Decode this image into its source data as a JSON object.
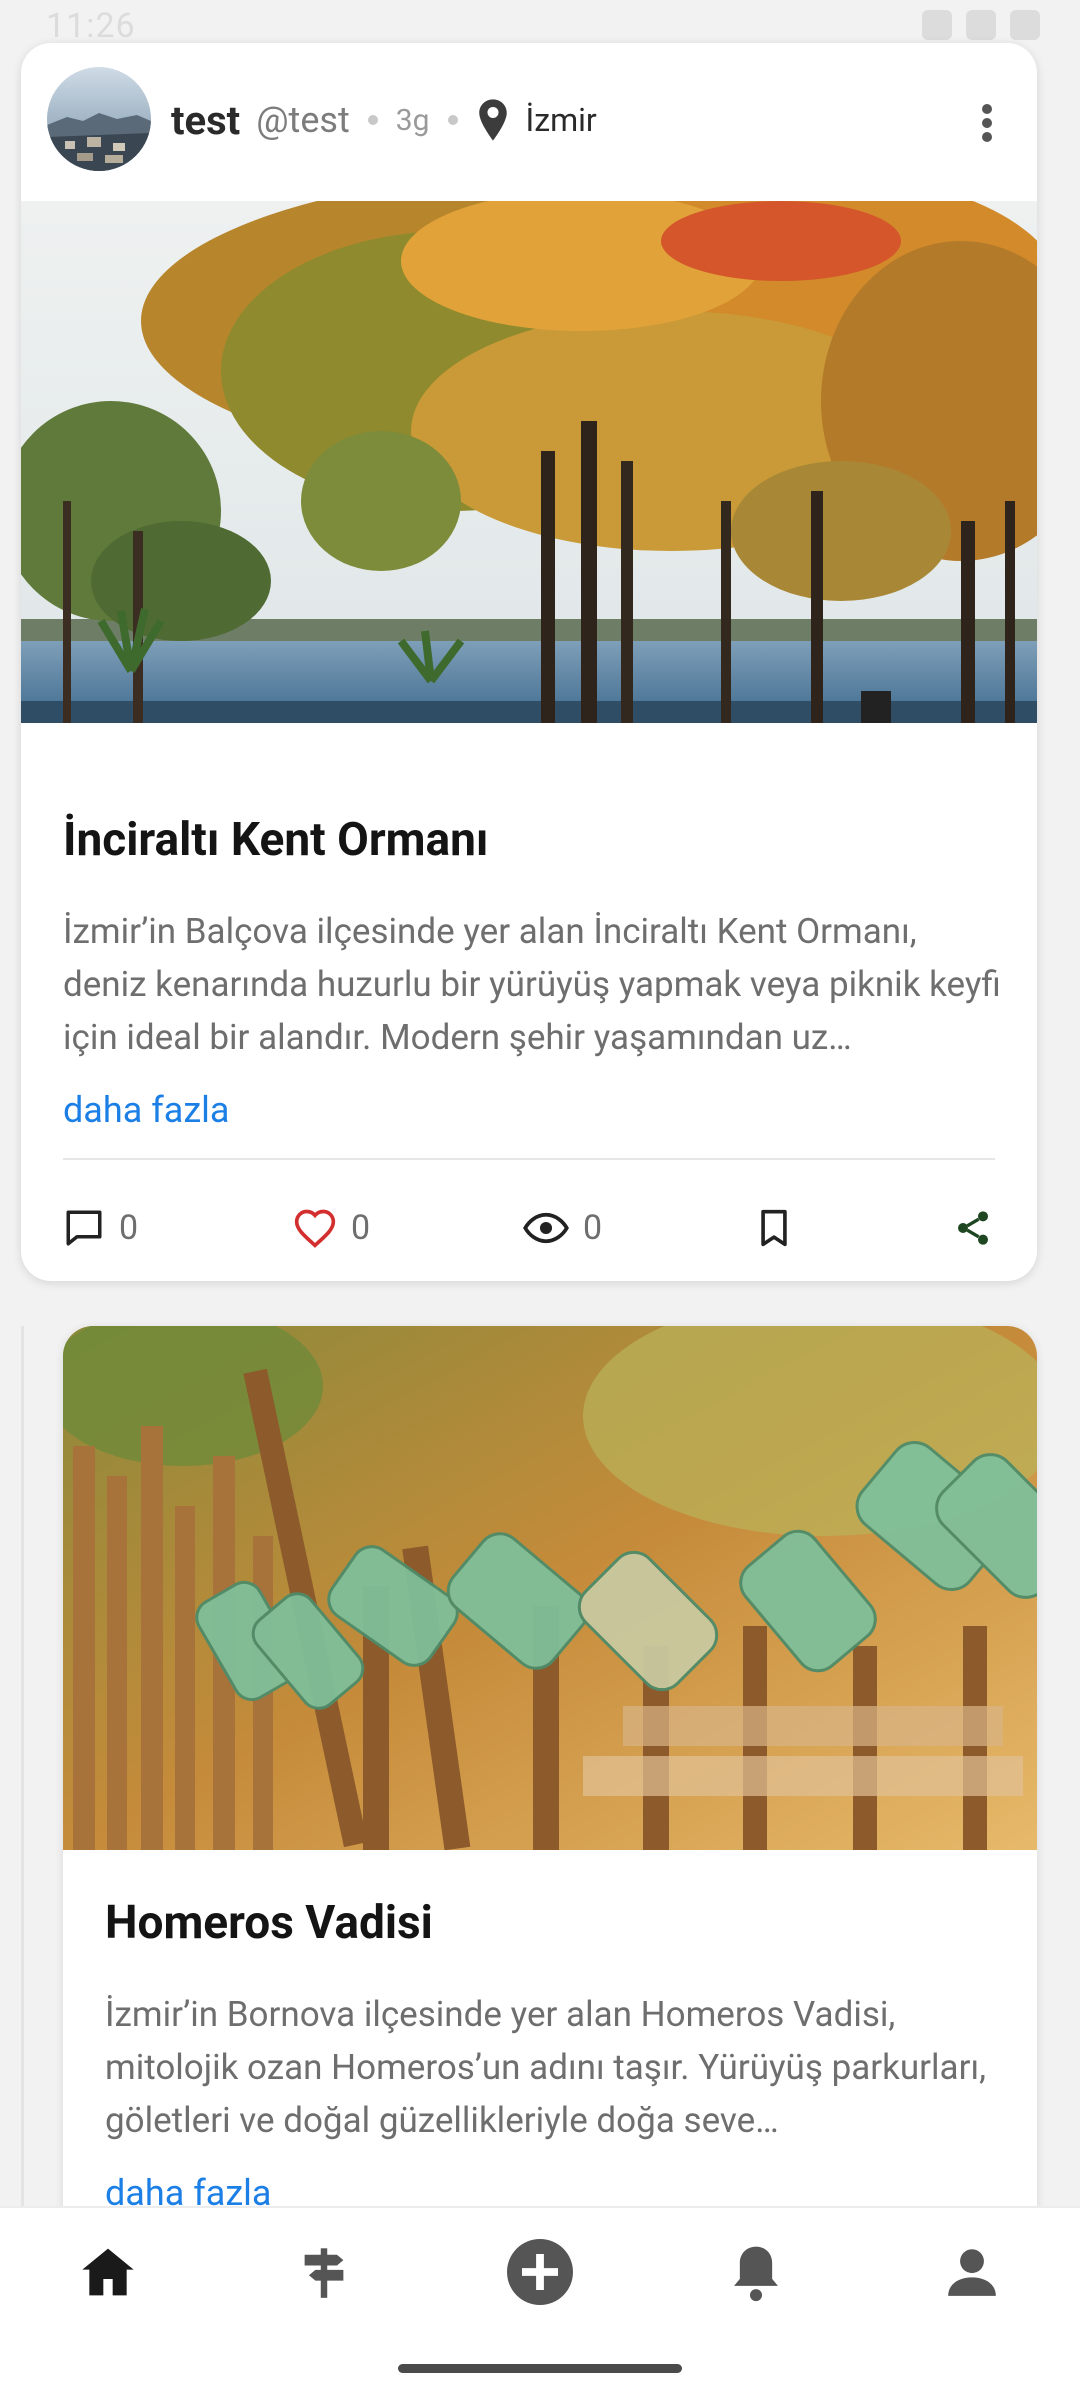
{
  "status_bar": {
    "time": "11:26"
  },
  "post1": {
    "user_name": "test",
    "user_handle": "@test",
    "time_ago": "3g",
    "location": "İzmir",
    "icons": {
      "location": "location-pin-icon",
      "more": "more-vertical-icon"
    },
    "image_alt": "Lakeside trees in autumn colors",
    "title": "İnciraltı Kent Ormanı",
    "description": "İzmir’in Balçova ilçesinde yer alan İnciraltı Kent Ormanı, deniz kenarında huzurlu bir yürüyüş yapmak veya piknik keyfi için ideal bir alandır. Modern şehir yaşamından uz…",
    "more_label": "daha fazla",
    "actions": {
      "comments": "0",
      "likes": "0",
      "views": "0"
    }
  },
  "post2": {
    "image_alt": "Glass jars hung on a wooden fence",
    "title": "Homeros Vadisi",
    "description": "İzmir’in Bornova ilçesinde yer alan Homeros Vadisi, mitolojik ozan Homeros’un adını taşır. Yürüyüş parkurları, göletleri ve doğal güzellikleriyle doğa seve…",
    "more_label": "daha fazla"
  },
  "bottom_nav": {
    "items": [
      "home-icon",
      "signpost-icon",
      "add-circle-icon",
      "notifications-icon",
      "profile-icon"
    ],
    "active": "home-icon"
  },
  "colors": {
    "link": "#1c7fe6",
    "like": "#d32f2f",
    "share": "#1e4620",
    "text_dark": "#141414",
    "text_muted": "#6e6e6e"
  }
}
